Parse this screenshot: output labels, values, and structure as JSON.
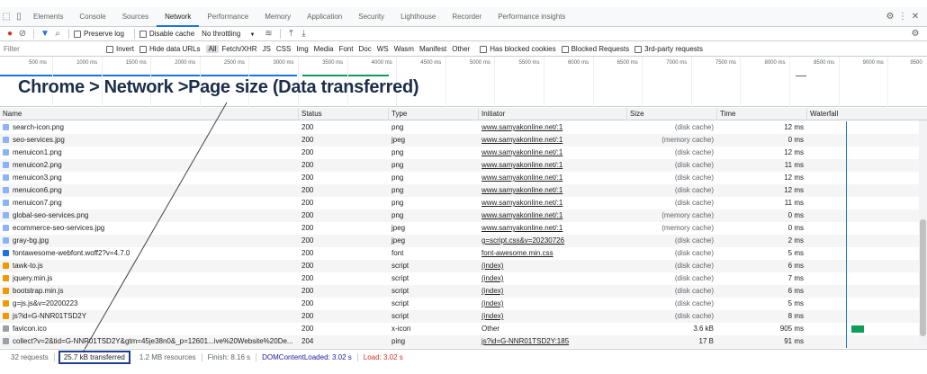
{
  "devtools_tabs": [
    "Elements",
    "Console",
    "Sources",
    "Network",
    "Performance",
    "Memory",
    "Application",
    "Security",
    "Lighthouse",
    "Recorder",
    "Performance insights"
  ],
  "active_tab": "Network",
  "toolbar": {
    "preserve_log": "Preserve log",
    "disable_cache": "Disable cache",
    "throttling": "No throttling"
  },
  "filter": {
    "placeholder": "Filter",
    "invert": "Invert",
    "hide_data_urls": "Hide data URLs",
    "types": [
      "All",
      "Fetch/XHR",
      "JS",
      "CSS",
      "Img",
      "Media",
      "Font",
      "Doc",
      "WS",
      "Wasm",
      "Manifest",
      "Other"
    ],
    "blocked_cookies": "Has blocked cookies",
    "blocked_requests": "Blocked Requests",
    "third_party": "3rd-party requests"
  },
  "timeline_ticks": [
    "500 ms",
    "1000 ms",
    "1500 ms",
    "2000 ms",
    "2500 ms",
    "3000 ms",
    "3500 ms",
    "4000 ms",
    "4500 ms",
    "5000 ms",
    "5500 ms",
    "6000 ms",
    "6500 ms",
    "7000 ms",
    "7500 ms",
    "8000 ms",
    "8500 ms",
    "9000 ms",
    "9500"
  ],
  "annotation": "Chrome > Network >Page size (Data transferred)",
  "columns": {
    "name": "Name",
    "status": "Status",
    "type": "Type",
    "initiator": "Initiator",
    "size": "Size",
    "time": "Time",
    "waterfall": "Waterfall"
  },
  "rows": [
    {
      "name": "search-icon.png",
      "status": "200",
      "type": "png",
      "initiator": "www.samyakonline.net/:1",
      "size": "(disk cache)",
      "time": "12 ms",
      "icon": "image"
    },
    {
      "name": "seo-services.jpg",
      "status": "200",
      "type": "jpeg",
      "initiator": "www.samyakonline.net/:1",
      "size": "(memory cache)",
      "time": "0 ms",
      "icon": "image"
    },
    {
      "name": "menuicon1.png",
      "status": "200",
      "type": "png",
      "initiator": "www.samyakonline.net/:1",
      "size": "(disk cache)",
      "time": "12 ms",
      "icon": "image"
    },
    {
      "name": "menuicon2.png",
      "status": "200",
      "type": "png",
      "initiator": "www.samyakonline.net/:1",
      "size": "(disk cache)",
      "time": "11 ms",
      "icon": "image"
    },
    {
      "name": "menuicon3.png",
      "status": "200",
      "type": "png",
      "initiator": "www.samyakonline.net/:1",
      "size": "(disk cache)",
      "time": "12 ms",
      "icon": "image"
    },
    {
      "name": "menuicon6.png",
      "status": "200",
      "type": "png",
      "initiator": "www.samyakonline.net/:1",
      "size": "(disk cache)",
      "time": "12 ms",
      "icon": "image"
    },
    {
      "name": "menuicon7.png",
      "status": "200",
      "type": "png",
      "initiator": "www.samyakonline.net/:1",
      "size": "(disk cache)",
      "time": "11 ms",
      "icon": "image"
    },
    {
      "name": "global-seo-services.png",
      "status": "200",
      "type": "png",
      "initiator": "www.samyakonline.net/:1",
      "size": "(memory cache)",
      "time": "0 ms",
      "icon": "image"
    },
    {
      "name": "ecommerce-seo-services.jpg",
      "status": "200",
      "type": "jpeg",
      "initiator": "www.samyakonline.net/:1",
      "size": "(memory cache)",
      "time": "0 ms",
      "icon": "image"
    },
    {
      "name": "gray-bg.jpg",
      "status": "200",
      "type": "jpeg",
      "initiator": "g=script.css&v=20230726",
      "size": "(disk cache)",
      "time": "2 ms",
      "icon": "image"
    },
    {
      "name": "fontawesome-webfont.woff2?v=4.7.0",
      "status": "200",
      "type": "font",
      "initiator": "font-awesome.min.css",
      "size": "(disk cache)",
      "time": "5 ms",
      "icon": "font"
    },
    {
      "name": "tawk-to.js",
      "status": "200",
      "type": "script",
      "initiator": "(index)",
      "size": "(disk cache)",
      "time": "6 ms",
      "icon": "script"
    },
    {
      "name": "jquery.min.js",
      "status": "200",
      "type": "script",
      "initiator": "(index)",
      "size": "(disk cache)",
      "time": "7 ms",
      "icon": "script"
    },
    {
      "name": "bootstrap.min.js",
      "status": "200",
      "type": "script",
      "initiator": "(index)",
      "size": "(disk cache)",
      "time": "6 ms",
      "icon": "script"
    },
    {
      "name": "g=js.js&v=20200223",
      "status": "200",
      "type": "script",
      "initiator": "(index)",
      "size": "(disk cache)",
      "time": "5 ms",
      "icon": "script"
    },
    {
      "name": "js?id=G-NNR01TSD2Y",
      "status": "200",
      "type": "script",
      "initiator": "(index)",
      "size": "(disk cache)",
      "time": "8 ms",
      "icon": "script"
    },
    {
      "name": "favicon.ico",
      "status": "200",
      "type": "x-icon",
      "initiator": "Other",
      "size": "3.6 kB",
      "time": "905 ms",
      "icon": "doc"
    },
    {
      "name": "collect?v=2&tid=G-NNR01TSD2Y&gtm=45je38n0&_p=12601...ive%20Website%20De...",
      "status": "204",
      "type": "ping",
      "initiator": "js?id=G-NNR01TSD2Y:185",
      "size": "17 B",
      "time": "91 ms",
      "icon": "doc"
    }
  ],
  "status_bar": {
    "requests": "32 requests",
    "transferred": "25.7 kB transferred",
    "resources": "1.2 MB resources",
    "finish": "Finish: 8.16 s",
    "dom_loaded": "DOMContentLoaded: 3.02 s",
    "load": "Load: 3.02 s"
  },
  "colors": {
    "accent": "#1a73e8",
    "dom_loaded": "#1a1aa6",
    "load": "#d93025",
    "annotation": "#1c2e4a"
  }
}
